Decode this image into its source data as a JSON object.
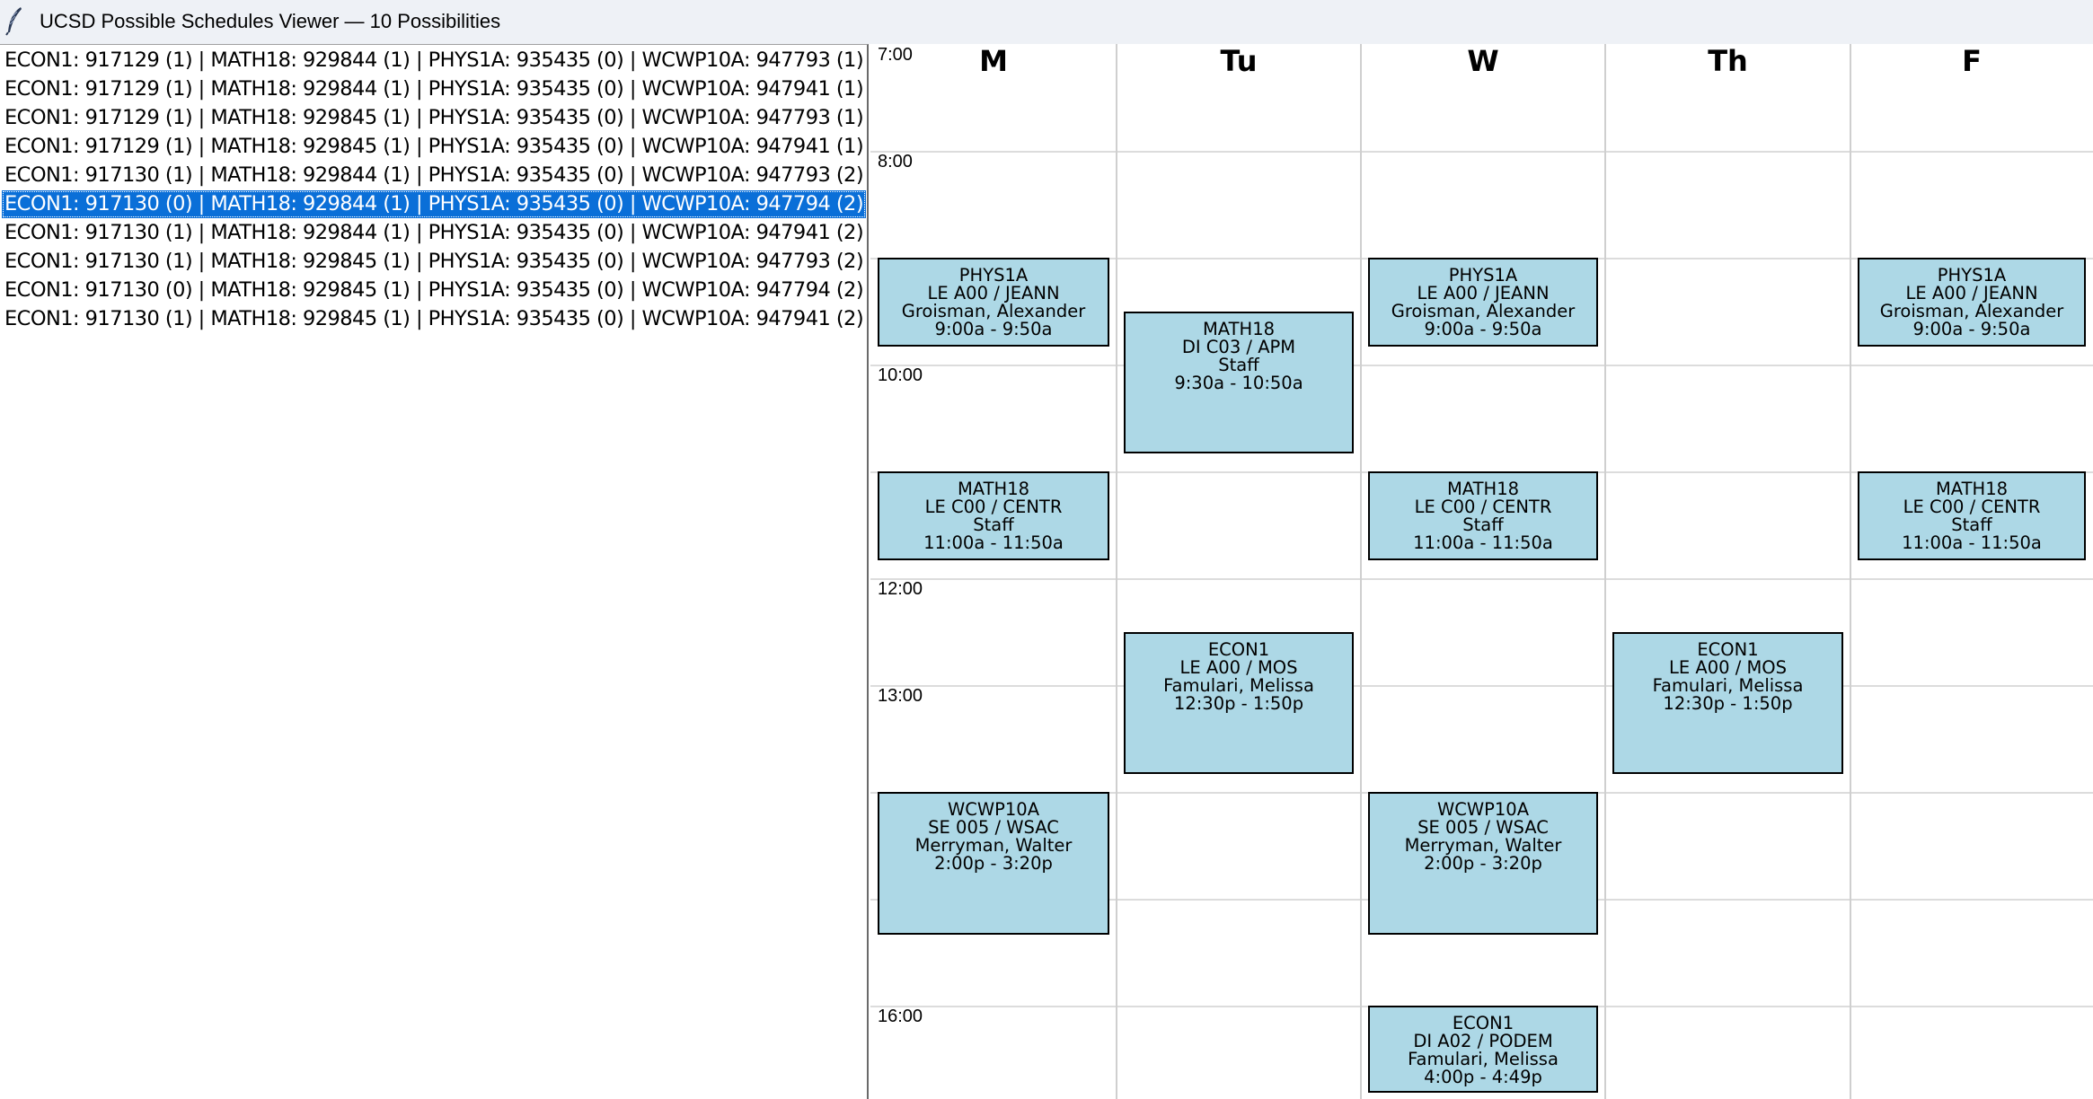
{
  "window": {
    "title": "UCSD Possible Schedules Viewer — 10 Possibilities",
    "icon": "feather-icon"
  },
  "schedules": [
    "ECON1: 917129 (1) | MATH18: 929844 (1) | PHYS1A: 935435 (0) | WCWP10A: 947793 (1)",
    "ECON1: 917129 (1) | MATH18: 929844 (1) | PHYS1A: 935435 (0) | WCWP10A: 947941 (1)",
    "ECON1: 917129 (1) | MATH18: 929845 (1) | PHYS1A: 935435 (0) | WCWP10A: 947793 (1)",
    "ECON1: 917129 (1) | MATH18: 929845 (1) | PHYS1A: 935435 (0) | WCWP10A: 947941 (1)",
    "ECON1: 917130 (1) | MATH18: 929844 (1) | PHYS1A: 935435 (0) | WCWP10A: 947793 (2)",
    "ECON1: 917130 (0) | MATH18: 929844 (1) | PHYS1A: 935435 (0) | WCWP10A: 947794 (2)",
    "ECON1: 917130 (1) | MATH18: 929844 (1) | PHYS1A: 935435 (0) | WCWP10A: 947941 (2)",
    "ECON1: 917130 (1) | MATH18: 929845 (1) | PHYS1A: 935435 (0) | WCWP10A: 947793 (2)",
    "ECON1: 917130 (0) | MATH18: 929845 (1) | PHYS1A: 935435 (0) | WCWP10A: 947794 (2)",
    "ECON1: 917130 (1) | MATH18: 929845 (1) | PHYS1A: 935435 (0) | WCWP10A: 947941 (2)"
  ],
  "selected_index": 5,
  "calendar": {
    "days": [
      "M",
      "Tu",
      "W",
      "Th",
      "F"
    ],
    "time_labels": [
      "7:00",
      "8:00",
      "10:00",
      "12:00",
      "13:00",
      "16:00"
    ],
    "events": [
      {
        "day": 0,
        "start": "9:00",
        "end": "9:50",
        "lines": [
          "PHYS1A",
          "LE A00 / JEANN",
          "Groisman, Alexander",
          "9:00a - 9:50a"
        ]
      },
      {
        "day": 2,
        "start": "9:00",
        "end": "9:50",
        "lines": [
          "PHYS1A",
          "LE A00 / JEANN",
          "Groisman, Alexander",
          "9:00a - 9:50a"
        ]
      },
      {
        "day": 4,
        "start": "9:00",
        "end": "9:50",
        "lines": [
          "PHYS1A",
          "LE A00 / JEANN",
          "Groisman, Alexander",
          "9:00a - 9:50a"
        ]
      },
      {
        "day": 1,
        "start": "9:30",
        "end": "10:50",
        "lines": [
          "MATH18",
          "DI C03 / APM",
          "Staff",
          "9:30a - 10:50a"
        ]
      },
      {
        "day": 0,
        "start": "11:00",
        "end": "11:50",
        "lines": [
          "MATH18",
          "LE C00 / CENTR",
          "Staff",
          "11:00a - 11:50a"
        ]
      },
      {
        "day": 2,
        "start": "11:00",
        "end": "11:50",
        "lines": [
          "MATH18",
          "LE C00 / CENTR",
          "Staff",
          "11:00a - 11:50a"
        ]
      },
      {
        "day": 4,
        "start": "11:00",
        "end": "11:50",
        "lines": [
          "MATH18",
          "LE C00 / CENTR",
          "Staff",
          "11:00a - 11:50a"
        ]
      },
      {
        "day": 1,
        "start": "12:30",
        "end": "13:50",
        "lines": [
          "ECON1",
          "LE A00 / MOS",
          "Famulari, Melissa",
          "12:30p - 1:50p"
        ]
      },
      {
        "day": 3,
        "start": "12:30",
        "end": "13:50",
        "lines": [
          "ECON1",
          "LE A00 / MOS",
          "Famulari, Melissa",
          "12:30p - 1:50p"
        ]
      },
      {
        "day": 0,
        "start": "14:00",
        "end": "15:20",
        "lines": [
          "WCWP10A",
          "SE 005 / WSAC",
          "Merryman, Walter",
          "2:00p - 3:20p"
        ]
      },
      {
        "day": 2,
        "start": "14:00",
        "end": "15:20",
        "lines": [
          "WCWP10A",
          "SE 005 / WSAC",
          "Merryman, Walter",
          "2:00p - 3:20p"
        ]
      },
      {
        "day": 2,
        "start": "16:00",
        "end": "16:49",
        "lines": [
          "ECON1",
          "DI A02 / PODEM",
          "Famulari, Melissa",
          "4:00p - 4:49p"
        ]
      }
    ]
  }
}
